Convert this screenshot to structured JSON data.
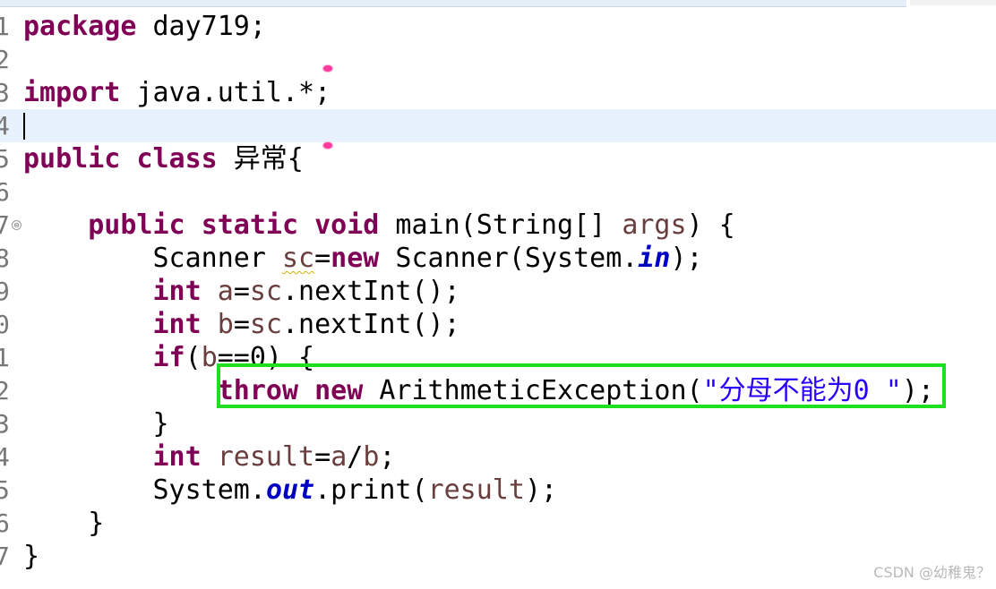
{
  "lines": [
    {
      "n": "1",
      "parts": [
        {
          "t": "package",
          "c": "kw"
        },
        {
          "t": " day719;",
          "c": ""
        }
      ]
    },
    {
      "n": "2",
      "parts": []
    },
    {
      "n": "3",
      "parts": [
        {
          "t": "import",
          "c": "kw"
        },
        {
          "t": " java.util.*;",
          "c": ""
        }
      ]
    },
    {
      "n": "4",
      "parts": []
    },
    {
      "n": "5",
      "parts": [
        {
          "t": "public",
          "c": "kw"
        },
        {
          "t": " ",
          "c": ""
        },
        {
          "t": "class",
          "c": "kw"
        },
        {
          "t": " 异常{",
          "c": ""
        }
      ]
    },
    {
      "n": "6",
      "parts": []
    },
    {
      "n": "7",
      "parts": [
        {
          "t": "    ",
          "c": ""
        },
        {
          "t": "public",
          "c": "kw"
        },
        {
          "t": " ",
          "c": ""
        },
        {
          "t": "static",
          "c": "kw"
        },
        {
          "t": " ",
          "c": ""
        },
        {
          "t": "void",
          "c": "kw"
        },
        {
          "t": " main(String[] ",
          "c": ""
        },
        {
          "t": "args",
          "c": "var"
        },
        {
          "t": ") {",
          "c": ""
        }
      ]
    },
    {
      "n": "8",
      "parts": [
        {
          "t": "        Scanner ",
          "c": ""
        },
        {
          "t": "sc",
          "c": "var squiggle"
        },
        {
          "t": "=",
          "c": ""
        },
        {
          "t": "new",
          "c": "kw"
        },
        {
          "t": " Scanner(System.",
          "c": ""
        },
        {
          "t": "in",
          "c": "field"
        },
        {
          "t": ");",
          "c": ""
        }
      ]
    },
    {
      "n": "9",
      "parts": [
        {
          "t": "        ",
          "c": ""
        },
        {
          "t": "int",
          "c": "kw"
        },
        {
          "t": " ",
          "c": ""
        },
        {
          "t": "a",
          "c": "var"
        },
        {
          "t": "=",
          "c": ""
        },
        {
          "t": "sc",
          "c": "var"
        },
        {
          "t": ".nextInt();",
          "c": ""
        }
      ]
    },
    {
      "n": "0",
      "parts": [
        {
          "t": "        ",
          "c": ""
        },
        {
          "t": "int",
          "c": "kw"
        },
        {
          "t": " ",
          "c": ""
        },
        {
          "t": "b",
          "c": "var"
        },
        {
          "t": "=",
          "c": ""
        },
        {
          "t": "sc",
          "c": "var"
        },
        {
          "t": ".nextInt();",
          "c": ""
        }
      ]
    },
    {
      "n": "1",
      "parts": [
        {
          "t": "        ",
          "c": ""
        },
        {
          "t": "if",
          "c": "kw"
        },
        {
          "t": "(",
          "c": ""
        },
        {
          "t": "b",
          "c": "var"
        },
        {
          "t": "==0) {",
          "c": ""
        }
      ]
    },
    {
      "n": "2",
      "parts": [
        {
          "t": "            ",
          "c": ""
        },
        {
          "t": "throw",
          "c": "kw"
        },
        {
          "t": " ",
          "c": ""
        },
        {
          "t": "new",
          "c": "kw"
        },
        {
          "t": " ArithmeticException(",
          "c": ""
        },
        {
          "t": "\"分母不能为0 \"",
          "c": "str"
        },
        {
          "t": ");",
          "c": ""
        }
      ]
    },
    {
      "n": "3",
      "parts": [
        {
          "t": "        }",
          "c": ""
        }
      ]
    },
    {
      "n": "4",
      "parts": [
        {
          "t": "        ",
          "c": ""
        },
        {
          "t": "int",
          "c": "kw"
        },
        {
          "t": " ",
          "c": ""
        },
        {
          "t": "result",
          "c": "var"
        },
        {
          "t": "=",
          "c": ""
        },
        {
          "t": "a",
          "c": "var"
        },
        {
          "t": "/",
          "c": ""
        },
        {
          "t": "b",
          "c": "var"
        },
        {
          "t": ";",
          "c": ""
        }
      ]
    },
    {
      "n": "5",
      "parts": [
        {
          "t": "        System.",
          "c": ""
        },
        {
          "t": "out",
          "c": "field"
        },
        {
          "t": ".print(",
          "c": ""
        },
        {
          "t": "result",
          "c": "var"
        },
        {
          "t": ");",
          "c": ""
        }
      ]
    },
    {
      "n": "6",
      "parts": [
        {
          "t": "    }",
          "c": ""
        }
      ]
    },
    {
      "n": "7",
      "parts": [
        {
          "t": "}",
          "c": ""
        }
      ]
    }
  ],
  "current_line_index": 3,
  "fold_icon_glyph": "⊖",
  "watermark": "CSDN @幼稚鬼？",
  "colors": {
    "keyword": "#7f0055",
    "string": "#2a00ff",
    "static_field": "#0000c0",
    "local_variable": "#6a3e3e",
    "current_line": "#e8f2fe",
    "highlight_box": "#1ee01e",
    "line_number": "#787878"
  },
  "icons": [
    "fold-collapse-icon",
    "annotation-marker-icon",
    "text-cursor-icon"
  ]
}
